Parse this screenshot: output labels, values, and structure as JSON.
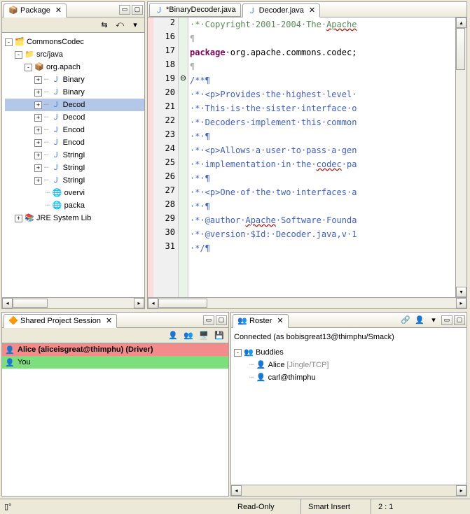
{
  "package_view": {
    "title": "Package",
    "tree": {
      "root": "CommonsCodec",
      "src": "src/java",
      "pkg": "org.apach",
      "items": [
        "Binary",
        "Binary",
        "Decod",
        "Decod",
        "Encod",
        "Encod",
        "StringI",
        "StringI",
        "StringI",
        "overvi",
        "packa"
      ],
      "jre": "JRE System Lib"
    }
  },
  "editor": {
    "tabs": [
      {
        "label": "*BinaryDecoder.java",
        "active": false
      },
      {
        "label": "Decoder.java",
        "active": true
      }
    ],
    "lines": [
      {
        "n": "2",
        "frag": [
          {
            "cls": "c-comment",
            "t": " * Copyright 2001-2004 The "
          },
          {
            "cls": "c-comment c-under",
            "t": "Apache"
          }
        ]
      },
      {
        "n": "16",
        "frag": [
          {
            "cls": "c-dot",
            "t": "¶"
          }
        ]
      },
      {
        "n": "17",
        "frag": [
          {
            "cls": "c-kw",
            "t": "package"
          },
          {
            "cls": "c-pkg",
            "t": " org.apache.commons.codec;"
          }
        ]
      },
      {
        "n": "18",
        "frag": [
          {
            "cls": "c-dot",
            "t": "¶"
          }
        ]
      },
      {
        "n": "19",
        "frag": [
          {
            "cls": "c-doc",
            "t": "/**¶"
          }
        ],
        "fold": "⊖"
      },
      {
        "n": "20",
        "frag": [
          {
            "cls": "c-doc",
            "t": " * <p>Provides the highest level "
          }
        ]
      },
      {
        "n": "21",
        "frag": [
          {
            "cls": "c-doc",
            "t": " * This is the sister interface o"
          }
        ]
      },
      {
        "n": "22",
        "frag": [
          {
            "cls": "c-doc",
            "t": " * Decoders implement this common"
          }
        ]
      },
      {
        "n": "23",
        "frag": [
          {
            "cls": "c-doc",
            "t": " * ¶"
          }
        ]
      },
      {
        "n": "24",
        "frag": [
          {
            "cls": "c-doc",
            "t": " * <p>Allows a user to pass a gen"
          }
        ]
      },
      {
        "n": "25",
        "frag": [
          {
            "cls": "c-doc",
            "t": " * implementation in the "
          },
          {
            "cls": "c-doc c-under",
            "t": "codec"
          },
          {
            "cls": "c-doc",
            "t": " pa"
          }
        ]
      },
      {
        "n": "26",
        "frag": [
          {
            "cls": "c-doc",
            "t": " * ¶"
          }
        ]
      },
      {
        "n": "27",
        "frag": [
          {
            "cls": "c-doc",
            "t": " * <p>One of the two interfaces a"
          }
        ]
      },
      {
        "n": "28",
        "frag": [
          {
            "cls": "c-doc",
            "t": " * ¶"
          }
        ]
      },
      {
        "n": "29",
        "frag": [
          {
            "cls": "c-doc",
            "t": " * @author "
          },
          {
            "cls": "c-doc c-under",
            "t": "Apache"
          },
          {
            "cls": "c-doc",
            "t": " Software Founda"
          }
        ]
      },
      {
        "n": "30",
        "frag": [
          {
            "cls": "c-doc",
            "t": " * @version $Id: Decoder.java,v 1"
          }
        ]
      },
      {
        "n": "31",
        "frag": [
          {
            "cls": "c-doc",
            "t": " */¶"
          }
        ]
      }
    ]
  },
  "session": {
    "title": "Shared Project Session",
    "participants": [
      {
        "label": "Alice (aliceisgreat@thimphu) (Driver)",
        "cls": "alice",
        "bold": true
      },
      {
        "label": "You",
        "cls": "you",
        "bold": false
      }
    ]
  },
  "roster": {
    "title": "Roster",
    "status": "Connected (as bobisgreat13@thimphu/Smack)",
    "group": "Buddies",
    "buddies": [
      {
        "name": "Alice",
        "extra": "[Jingle/TCP]"
      },
      {
        "name": "carl@thimphu",
        "extra": ""
      }
    ]
  },
  "statusbar": {
    "readonly": "Read-Only",
    "insert": "Smart Insert",
    "pos": "2 : 1"
  }
}
